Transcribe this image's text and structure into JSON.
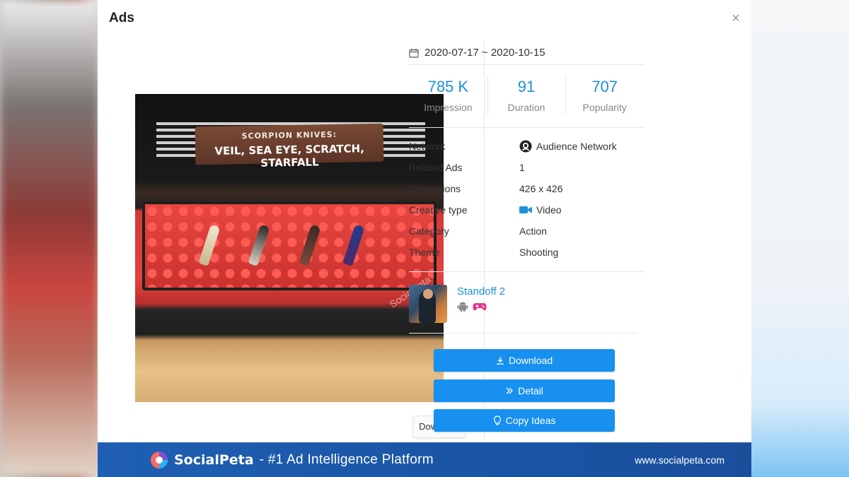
{
  "modal": {
    "title": "Ads"
  },
  "creative": {
    "sign_line1": "SCORPION KNIVES:",
    "sign_line2": "VEIL, SEA EYE, SCRATCH, STARFALL",
    "watermark": "SocialPeta"
  },
  "preview": {
    "download_label": "Download"
  },
  "date_range": "2020-07-17 ~ 2020-10-15",
  "stats": [
    {
      "value": "785 K",
      "label": "Impression"
    },
    {
      "value": "91",
      "label": "Duration"
    },
    {
      "value": "707",
      "label": "Popularity"
    }
  ],
  "info": [
    {
      "key": "Network",
      "value": "Audience Network",
      "icon": "audience-network-icon"
    },
    {
      "key": "Related Ads",
      "value": "1"
    },
    {
      "key": "Dimensions",
      "value": "426 x 426"
    },
    {
      "key": "Creative type",
      "value": "Video",
      "icon": "video-camera-icon"
    },
    {
      "key": "Category",
      "value": "Action"
    },
    {
      "key": "Theme",
      "value": "Shooting"
    }
  ],
  "app": {
    "name": "Standoff 2",
    "platforms": [
      "android-icon",
      "gamepad-icon"
    ]
  },
  "actions": {
    "download": "Download",
    "detail": "Detail",
    "copy_ideas": "Copy Ideas"
  },
  "banner": {
    "brand": "SocialPeta",
    "tagline": "- #1 Ad Intelligence Platform",
    "url": "www.socialpeta.com"
  },
  "colors": {
    "accent": "#1790f0",
    "link": "#1e90d6",
    "banner": "#1b56a6"
  }
}
